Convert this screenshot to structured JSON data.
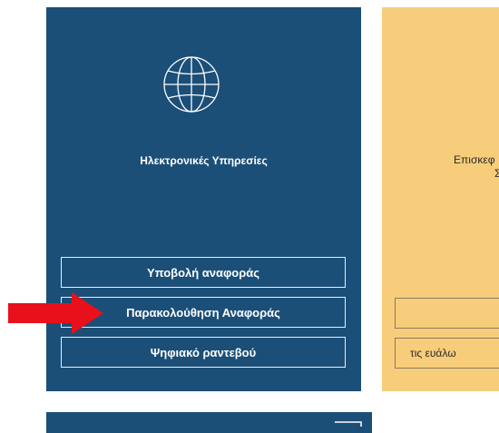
{
  "colors": {
    "blue_card": "#1b4f78",
    "yellow_card": "#f7cd7b",
    "arrow": "#e8101a"
  },
  "electronic_services": {
    "icon": "globe-icon",
    "title": "Ηλεκτρονικές Υπηρεσίες",
    "buttons": [
      {
        "label": "Υποβολή αναφοράς"
      },
      {
        "label": "Παρακολούθηση Αναφοράς"
      },
      {
        "label": "Ψηφιακό ραντεβού"
      }
    ]
  },
  "visit_card": {
    "text_line1": "Επισκεφ",
    "text_line2": "Σ",
    "buttons": [
      {
        "label": ""
      },
      {
        "label": "τις ευάλω"
      }
    ]
  },
  "annotation": {
    "icon": "arrow-right-icon"
  }
}
